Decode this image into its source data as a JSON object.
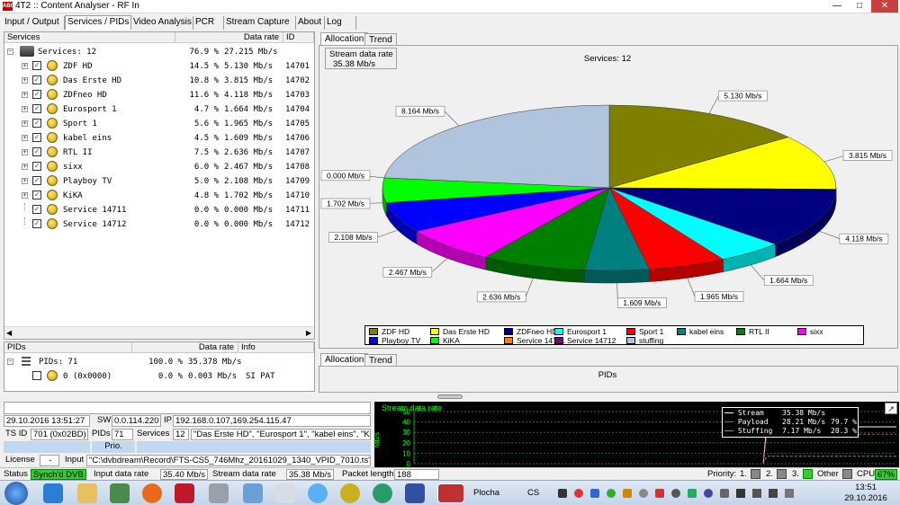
{
  "window": {
    "title": "4T2 :: Content Analyser - RF In",
    "icon_label": "ABC"
  },
  "main_tabs": [
    "Input / Output",
    "Services / PIDs",
    "Video Analysis",
    "PCR",
    "Stream Capture",
    "About",
    "Log"
  ],
  "services_table": {
    "headers": [
      "Services",
      "Data rate",
      "ID"
    ],
    "root": {
      "pct": "76.9 %",
      "rate": "27.215 Mb/s",
      "label": "Services: 12"
    },
    "rows": [
      {
        "name": "ZDF HD",
        "pct": "14.5 %",
        "rate": "5.130 Mb/s",
        "id": "14701",
        "expandable": true
      },
      {
        "name": "Das Erste HD",
        "pct": "10.8 %",
        "rate": "3.815 Mb/s",
        "id": "14702",
        "expandable": true
      },
      {
        "name": "ZDFneo HD",
        "pct": "11.6 %",
        "rate": "4.118 Mb/s",
        "id": "14703",
        "expandable": true
      },
      {
        "name": "Eurosport 1",
        "pct": "4.7 %",
        "rate": "1.664 Mb/s",
        "id": "14704",
        "expandable": true
      },
      {
        "name": "Sport 1",
        "pct": "5.6 %",
        "rate": "1.965 Mb/s",
        "id": "14705",
        "expandable": true
      },
      {
        "name": "kabel eins",
        "pct": "4.5 %",
        "rate": "1.609 Mb/s",
        "id": "14706",
        "expandable": true
      },
      {
        "name": "RTL II",
        "pct": "7.5 %",
        "rate": "2.636 Mb/s",
        "id": "14707",
        "expandable": true
      },
      {
        "name": "sixx",
        "pct": "6.0 %",
        "rate": "2.467 Mb/s",
        "id": "14708",
        "expandable": true
      },
      {
        "name": "Playboy TV",
        "pct": "5.0 %",
        "rate": "2.108 Mb/s",
        "id": "14709",
        "expandable": true
      },
      {
        "name": "KiKA",
        "pct": "4.8 %",
        "rate": "1.702 Mb/s",
        "id": "14710",
        "expandable": true
      },
      {
        "name": "Service 14711",
        "pct": "0.0 %",
        "rate": "0.000 Mb/s",
        "id": "14711",
        "expandable": false
      },
      {
        "name": "Service 14712",
        "pct": "0.0 %",
        "rate": "0.000 Mb/s",
        "id": "14712",
        "expandable": false
      }
    ]
  },
  "pids_table": {
    "headers": [
      "PIDs",
      "Data rate",
      "Info"
    ],
    "root": {
      "label": "PIDs: 71",
      "pct": "100.0 %",
      "rate": "35.378 Mb/s"
    },
    "rows": [
      {
        "label": "0 (0x0000)",
        "pct": "0.0 %",
        "rate": "0.003 Mb/s",
        "info": "SI PAT"
      }
    ]
  },
  "allocation": {
    "tabs": [
      "Allocation",
      "Trend"
    ],
    "stream_box_title": "Stream data rate",
    "stream_box_value": "35.38 Mb/s",
    "chart_title": "Services: 12",
    "pids_tabs": [
      "Allocation",
      "Trend"
    ],
    "pids_title": "PIDs"
  },
  "chart_data": {
    "type": "pie",
    "title": "Services: 12",
    "slices": [
      {
        "name": "ZDF HD",
        "value": 5.13,
        "label": "5.130 Mb/s",
        "color": "#808000"
      },
      {
        "name": "Das Erste HD",
        "value": 3.815,
        "label": "3.815 Mb/s",
        "color": "#ffff00"
      },
      {
        "name": "ZDFneo HD",
        "value": 4.118,
        "label": "4.118 Mb/s",
        "color": "#000080"
      },
      {
        "name": "Eurosport 1",
        "value": 1.664,
        "label": "1.664 Mb/s",
        "color": "#00ffff"
      },
      {
        "name": "Sport 1",
        "value": 1.965,
        "label": "1.965 Mb/s",
        "color": "#ff0000"
      },
      {
        "name": "kabel eins",
        "value": 1.609,
        "label": "1.609 Mb/s",
        "color": "#008080"
      },
      {
        "name": "RTL II",
        "value": 2.636,
        "label": "2.636 Mb/s",
        "color": "#008000"
      },
      {
        "name": "sixx",
        "value": 2.467,
        "label": "2.467 Mb/s",
        "color": "#ff00ff"
      },
      {
        "name": "Playboy TV",
        "value": 2.108,
        "label": "2.108 Mb/s",
        "color": "#0000ff"
      },
      {
        "name": "KiKA",
        "value": 1.702,
        "label": "1.702 Mb/s",
        "color": "#00ff00"
      },
      {
        "name": "Service 14711",
        "value": 0.0,
        "label": "",
        "color": "#ff8000"
      },
      {
        "name": "Service 14712",
        "value": 0.0,
        "label": "0.000 Mb/s",
        "color": "#800080"
      },
      {
        "name": "stuffing",
        "value": 8.164,
        "label": "8.164 Mb/s",
        "color": "#b0c4de"
      }
    ]
  },
  "info": {
    "datetime": "29.10.2016 13:51:27",
    "sw_label": "SW",
    "sw_value": "0.0.114.220",
    "ip_label": "IP",
    "ip_value": "192.168.0.107,169.254.115.47",
    "tsid_label": "TS ID",
    "tsid_value": "701 (0x02BD)",
    "pids_label": "PIDs",
    "pids_value": "71",
    "services_label": "Services",
    "services_value": "12",
    "services_list": "\"Das Erste HD\", \"Eurosport 1\", \"kabel eins\", \"K",
    "prio_label": "Prio.",
    "license_label": "License",
    "license_value": "-",
    "input_label": "Input",
    "input_value": "\"C:\\dvbdream\\Record\\FTS-CS5_746Mhz_20161029_1340_VPID_7010.ts\" L"
  },
  "mini_chart": {
    "title": "Stream data rate",
    "ylabel": "Mb/s",
    "yticks": [
      "50",
      "40",
      "30",
      "20",
      "10",
      "0"
    ],
    "legend": [
      {
        "name": "Stream",
        "value": "35.38 Mb/s",
        "pct": ""
      },
      {
        "name": "Payload",
        "value": "28.21 Mb/s",
        "pct": "79.7 %"
      },
      {
        "name": "Stuffing",
        "value": "7.17 Mb/s",
        "pct": "20.3 %"
      }
    ]
  },
  "status": {
    "status_label": "Status",
    "status_value": "Synch'd DVB",
    "input_rate_label": "Input data rate",
    "input_rate_value": "35.40 Mb/s",
    "stream_rate_label": "Stream data rate",
    "stream_rate_value": "35.38 Mb/s",
    "packet_label": "Packet length",
    "packet_value": "188",
    "priority_label": "Priority:",
    "p1": "1.",
    "p2": "2.",
    "p3": "3.",
    "other": "Other",
    "cpu_label": "CPU",
    "cpu_value": "67%"
  },
  "taskbar": {
    "time": "13:51",
    "date": "29.10.2016",
    "plocha": "Plocha",
    "lang": "CS"
  }
}
